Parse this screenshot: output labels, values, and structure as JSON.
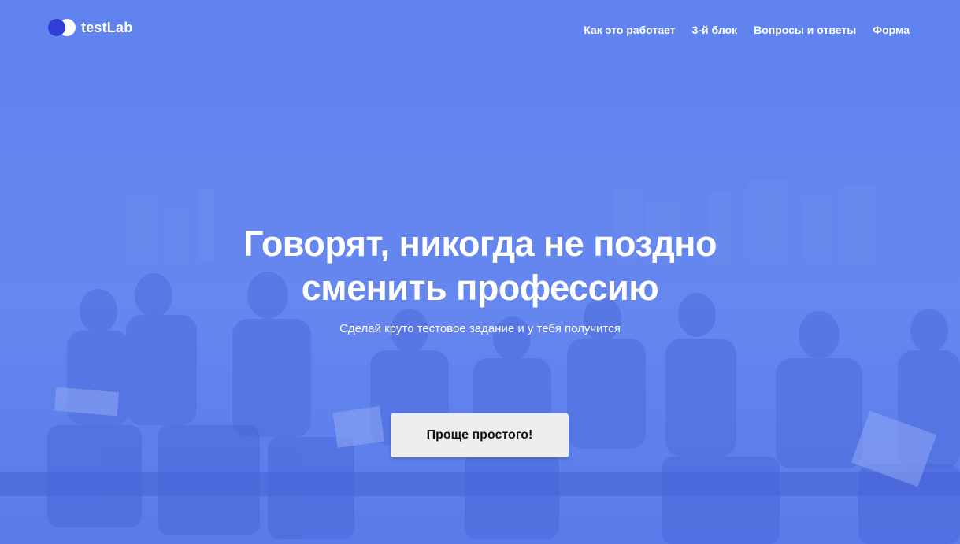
{
  "header": {
    "logo_text": "testLab",
    "nav": [
      {
        "label": "Как это работает"
      },
      {
        "label": "3-й блок"
      },
      {
        "label": "Вопросы и ответы"
      },
      {
        "label": "Форма"
      }
    ]
  },
  "hero": {
    "headline_line1": "Говорят, никогда не поздно",
    "headline_line2": "сменить профессию",
    "subheadline": "Сделай круто тестовое задание и у тебя получится",
    "cta_label": "Проще простого!",
    "background_description": "workers-sitting-on-beam-photo",
    "overlay_color": "#6283ee"
  },
  "colors": {
    "accent_dark": "#2f3fd6",
    "text_light": "#ffffff",
    "button_bg": "#eeeeee"
  }
}
